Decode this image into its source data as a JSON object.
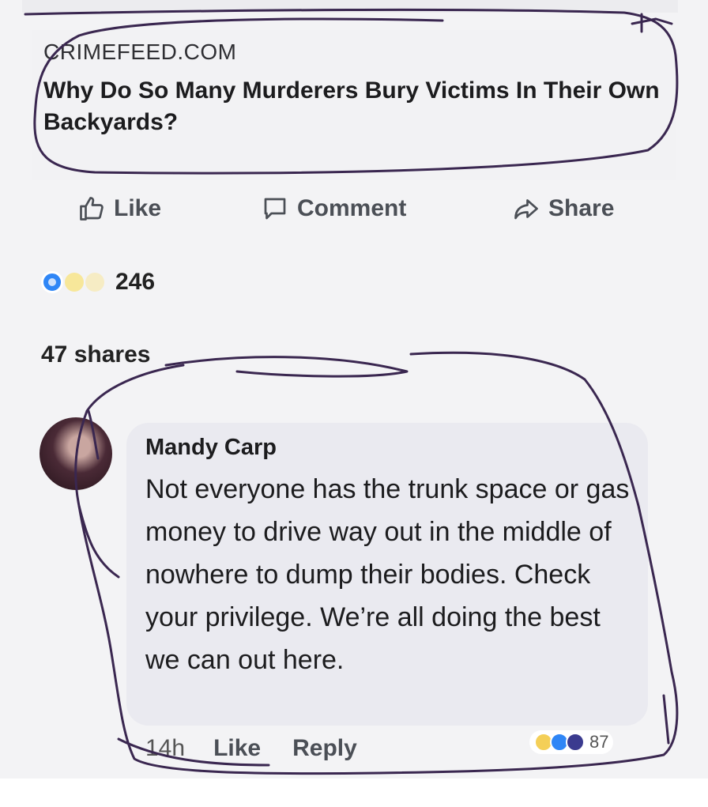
{
  "link_preview": {
    "domain": "CRIMEFEED.COM",
    "title": "Why Do So Many Murderers Bury Victims In Their Own Backyards?"
  },
  "actions": {
    "like_label": "Like",
    "comment_label": "Comment",
    "share_label": "Share"
  },
  "reactions": {
    "count": "246",
    "icons": [
      "like-reaction-icon",
      "love-reaction-icon",
      "haha-reaction-icon"
    ]
  },
  "shares_text": "47 shares",
  "comment": {
    "author": "Mandy Carp",
    "text": "Not everyone has the trunk space or gas money to drive way out in the middle of nowhere to dump their bodies. Check your privilege. We’re all doing the best we can out here.",
    "time": "14h",
    "like_label": "Like",
    "reply_label": "Reply",
    "reaction_count": "87"
  },
  "colors": {
    "annotation_ink": "#3a2750",
    "like_blue": "#2f86f6",
    "text_gray": "#4b4f56"
  }
}
